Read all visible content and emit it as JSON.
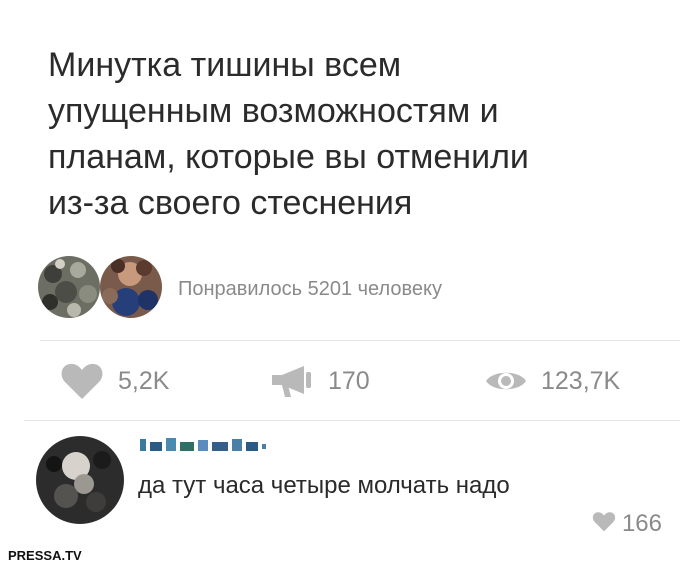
{
  "post": {
    "text_lines": [
      "Минутка тишины всем",
      "упущенным возможностям и",
      "планам, которые вы отменили",
      "из-за своего стеснения"
    ]
  },
  "likers": {
    "avatars": [
      "avatar-1",
      "avatar-2"
    ],
    "label": "Понравилось 5201 человеку"
  },
  "stats": {
    "likes": "5,2K",
    "reposts": "170",
    "views": "123,7K",
    "icons": {
      "likes": "heart-icon",
      "reposts": "megaphone-icon",
      "views": "eye-icon"
    },
    "icon_color": "#b9b9b9"
  },
  "comment": {
    "text": "да тут часа четыре молчать надо",
    "likes": "166"
  },
  "watermark": "PRESSA.TV"
}
